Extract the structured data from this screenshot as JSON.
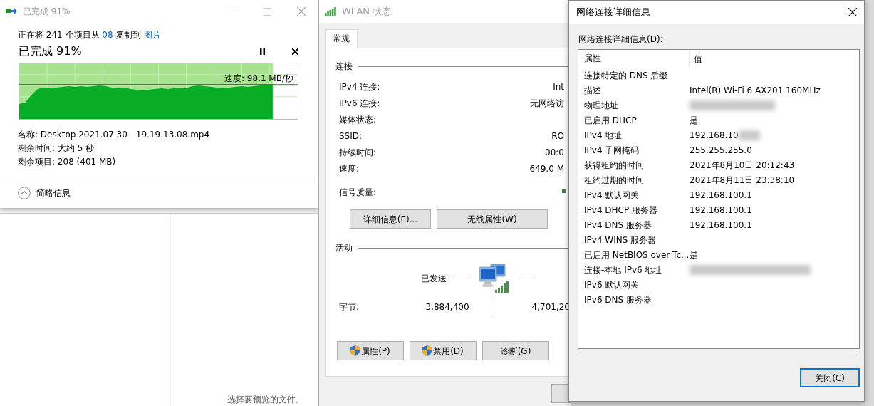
{
  "explorer": {
    "preview_hint": "选择要预览的文件。"
  },
  "copy_dialog": {
    "title": "已完成 91%",
    "summary": [
      {
        "text": "正在将 241 个项目从 ",
        "kind": "plain"
      },
      {
        "text": "08",
        "kind": "link"
      },
      {
        "text": " 复制到 ",
        "kind": "plain"
      },
      {
        "text": "图片",
        "kind": "link"
      }
    ],
    "heading": "已完成 91%",
    "progress": {
      "level": 0.91
    },
    "speed": "速度: 98.1 MB/秒",
    "details": [
      "名称: Desktop 2021.07.30 - 19.19.13.08.mp4",
      "剩余时间: 大约 5 秒",
      "剩余项目: 208 (401 MB)"
    ],
    "toggle": {
      "label": "简略信息",
      "expanded": true
    }
  },
  "wlan_status": {
    "title": "WLAN 状态",
    "tabs": [
      {
        "label": "常规",
        "selected": true
      }
    ],
    "connection": {
      "heading": "连接",
      "rows": [
        {
          "label": "IPv4 连接:",
          "value": "Int"
        },
        {
          "label": "IPv6 连接:",
          "value": "无网络访"
        },
        {
          "label": "媒体状态:"
        },
        {
          "label": "SSID:",
          "value": "RO"
        },
        {
          "label": "持续时间:",
          "value": "00:0"
        },
        {
          "label": "速度:",
          "value": "649.0 M"
        }
      ],
      "signal_label": "信号质量:"
    },
    "buttons": [
      {
        "label": "详细信息(E)..."
      },
      {
        "label": "无线属性(W)"
      }
    ],
    "activity": {
      "heading": "活动",
      "sent_label": "已发送",
      "bytes_label": "字节:",
      "bytes_sent": "3,884,400",
      "bytes_received": "4,701,20"
    },
    "action_buttons": [
      {
        "label": "属性(P)",
        "kind": "shield"
      },
      {
        "label": "禁用(D)",
        "kind": "shield"
      },
      {
        "label": "诊断(G)",
        "kind": "plain"
      }
    ]
  },
  "details_dialog": {
    "title": "网络连接详细信息",
    "list_label": "网络连接详细信息(D):",
    "columns": [
      "属性",
      "值"
    ],
    "rows": [
      {
        "property": "连接特定的 DNS 后缀"
      },
      {
        "property": "描述",
        "value": "Intel(R) Wi-Fi 6 AX201 160MHz"
      },
      {
        "property": "物理地址",
        "redacted": true
      },
      {
        "property": "已启用 DHCP",
        "value": "是"
      },
      {
        "property": "IPv4 地址",
        "value": "192.168.10",
        "redacted": true
      },
      {
        "property": "IPv4 子网掩码",
        "value": "255.255.255.0"
      },
      {
        "property": "获得租约的时间",
        "value": "2021年8月10日 20:12:43"
      },
      {
        "property": "租约过期的时间",
        "value": "2021年8月11日 23:38:10"
      },
      {
        "property": "IPv4 默认网关",
        "value": "192.168.100.1"
      },
      {
        "property": "IPv4 DHCP 服务器",
        "value": "192.168.100.1"
      },
      {
        "property": "IPv4 DNS 服务器",
        "value": "192.168.100.1"
      },
      {
        "property": "IPv4 WINS 服务器"
      },
      {
        "property": "已启用 NetBIOS over Tc...",
        "value": "是"
      },
      {
        "property": "连接-本地 IPv6 地址",
        "redacted": true
      },
      {
        "property": "IPv6 默认网关"
      },
      {
        "property": "IPv6 DNS 服务器"
      }
    ],
    "close_button": "关闭(C)"
  }
}
